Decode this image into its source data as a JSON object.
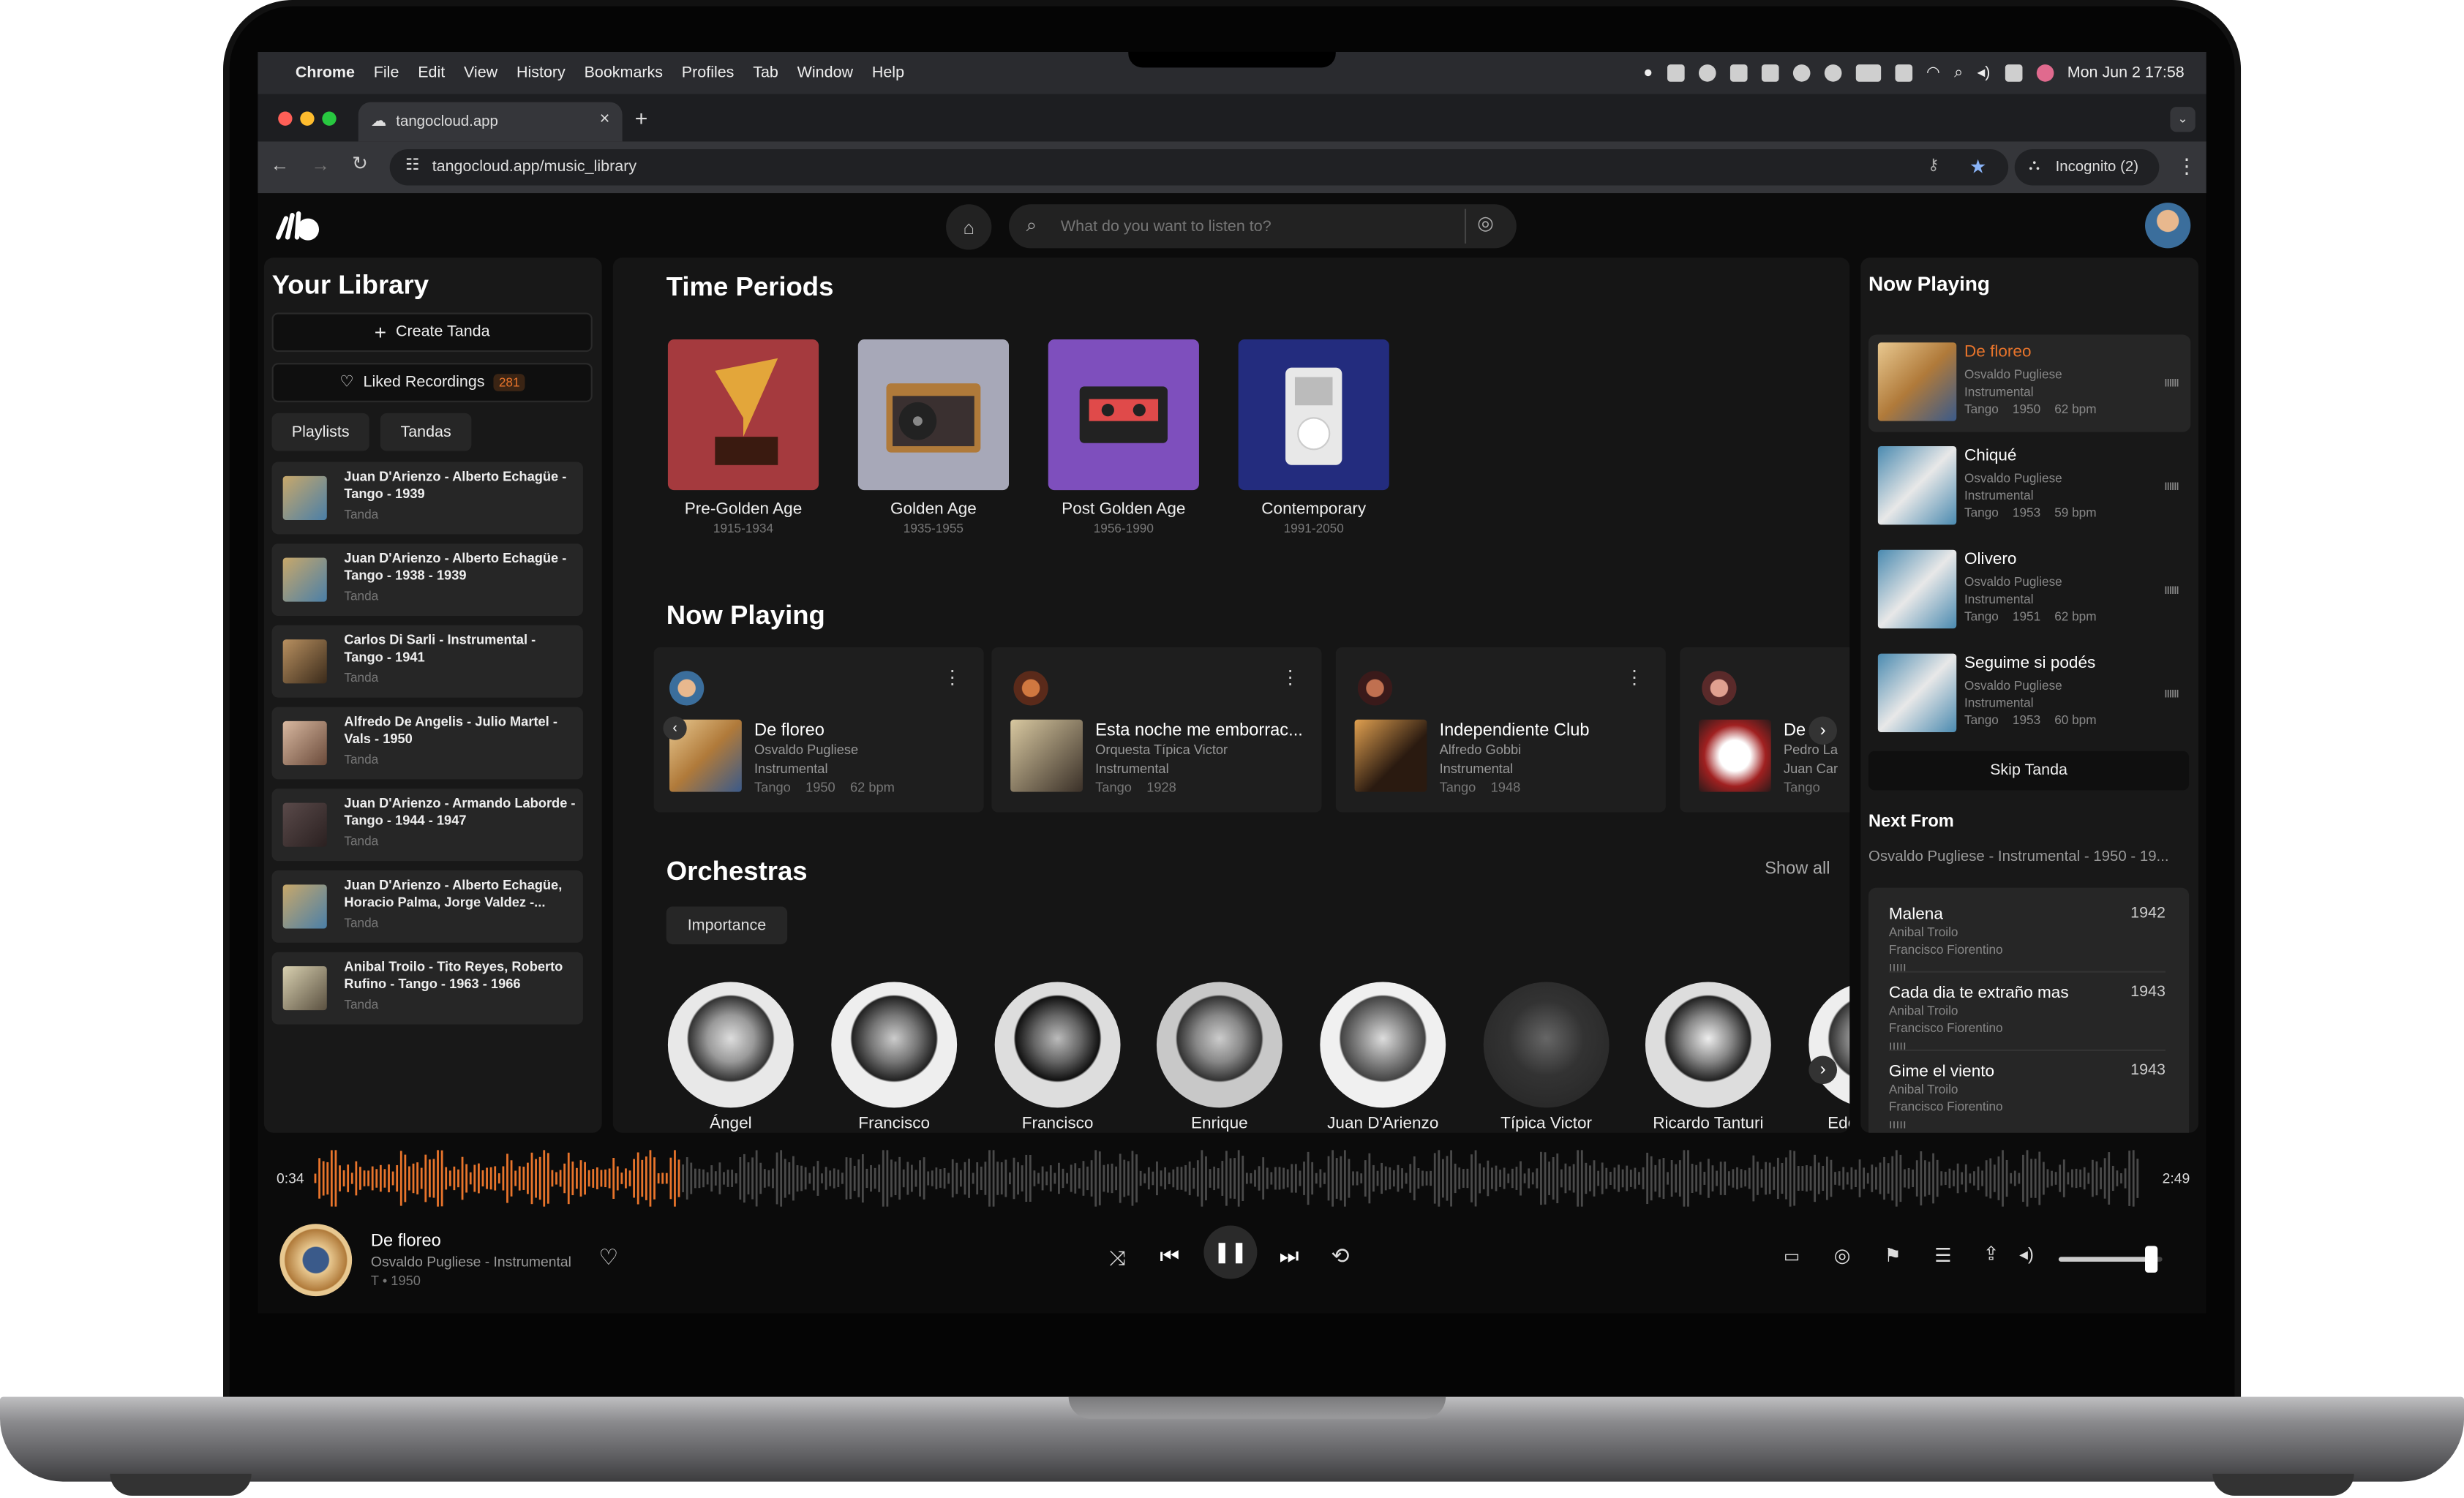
{
  "menubar": {
    "app": "Chrome",
    "items": [
      "File",
      "Edit",
      "View",
      "History",
      "Bookmarks",
      "Profiles",
      "Tab",
      "Window",
      "Help"
    ],
    "clock": "Mon Jun 2  17:58"
  },
  "browser": {
    "tab_title": "tangocloud.app",
    "url": "tangocloud.app/music_library",
    "incognito": "Incognito (2)"
  },
  "search": {
    "placeholder": "What do you want to listen to?"
  },
  "library": {
    "title": "Your Library",
    "create": "Create Tanda",
    "liked": "Liked Recordings",
    "liked_count": "281",
    "tabs": [
      "Playlists",
      "Tandas"
    ],
    "tandas": [
      {
        "title": "Juan D'Arienzo - Alberto Echagüe - Tango - 1939",
        "type": "Tanda"
      },
      {
        "title": "Juan D'Arienzo - Alberto Echagüe - Tango - 1938 - 1939",
        "type": "Tanda"
      },
      {
        "title": "Carlos Di Sarli - Instrumental - Tango - 1941",
        "type": "Tanda"
      },
      {
        "title": "Alfredo De Angelis - Julio Martel - Vals - 1950",
        "type": "Tanda"
      },
      {
        "title": "Juan D'Arienzo - Armando Laborde - Tango - 1944 - 1947",
        "type": "Tanda"
      },
      {
        "title": "Juan D'Arienzo - Alberto Echagüe, Horacio Palma, Jorge Valdez -...",
        "type": "Tanda"
      },
      {
        "title": "Anibal Troilo - Tito Reyes, Roberto Rufino - Tango - 1963 - 1966",
        "type": "Tanda"
      }
    ]
  },
  "main": {
    "periods_title": "Time Periods",
    "periods": [
      {
        "name": "Pre-Golden Age",
        "range": "1915-1934",
        "color": "#a53a3e"
      },
      {
        "name": "Golden Age",
        "range": "1935-1955",
        "color": "#a7a8b8"
      },
      {
        "name": "Post Golden Age",
        "range": "1956-1990",
        "color": "#7e4fbd"
      },
      {
        "name": "Contemporary",
        "range": "1991-2050",
        "color": "#232c7e"
      }
    ],
    "now_playing_title": "Now Playing",
    "now_cards": [
      {
        "title": "De floreo",
        "artist": "Osvaldo Pugliese",
        "kind": "Instrumental",
        "meta": "Tango    1950    62 bpm"
      },
      {
        "title": "Esta noche me emborrac...",
        "artist": "Orquesta Típica Victor",
        "kind": "Instrumental",
        "meta": "Tango    1928"
      },
      {
        "title": "Independiente Club",
        "artist": "Alfredo Gobbi",
        "kind": "Instrumental",
        "meta": "Tango    1948"
      },
      {
        "title": "De",
        "artist": "Pedro La",
        "kind": "Juan Car",
        "meta": "Tango"
      }
    ],
    "orchestras_title": "Orchestras",
    "show_all": "Show all",
    "filter": "Importance",
    "orchestras": [
      "Ángel",
      "Francisco",
      "Francisco",
      "Enrique",
      "Juan D'Arienzo",
      "Típica Victor",
      "Ricardo Tanturi",
      "Edgar"
    ]
  },
  "right": {
    "title": "Now Playing",
    "queue": [
      {
        "title": "De floreo",
        "artist": "Osvaldo Pugliese",
        "kind": "Instrumental",
        "meta": "Tango    1950    62 bpm",
        "active": true
      },
      {
        "title": "Chiqué",
        "artist": "Osvaldo Pugliese",
        "kind": "Instrumental",
        "meta": "Tango    1953    59 bpm"
      },
      {
        "title": "Olivero",
        "artist": "Osvaldo Pugliese",
        "kind": "Instrumental",
        "meta": "Tango    1951    62 bpm"
      },
      {
        "title": "Seguime si podés",
        "artist": "Osvaldo Pugliese",
        "kind": "Instrumental",
        "meta": "Tango    1953    60 bpm"
      }
    ],
    "skip": "Skip Tanda",
    "next_title": "Next From",
    "next_sub": "Osvaldo Pugliese - Instrumental - 1950 - 19...",
    "next": [
      {
        "title": "Malena",
        "year": "1942",
        "artist": "Anibal Troilo",
        "singer": "Francisco Fiorentino"
      },
      {
        "title": "Cada dia te extraño mas",
        "year": "1943",
        "artist": "Anibal Troilo",
        "singer": "Francisco Fiorentino"
      },
      {
        "title": "Gime el viento",
        "year": "1943",
        "artist": "Anibal Troilo",
        "singer": "Francisco Fiorentino"
      }
    ]
  },
  "player": {
    "elapsed": "0:34",
    "duration": "2:49",
    "progress": 0.2,
    "title": "De floreo",
    "artist": "Osvaldo Pugliese - Instrumental",
    "meta": "T • 1950",
    "volume": 0.9,
    "accent": "#e8742b"
  }
}
